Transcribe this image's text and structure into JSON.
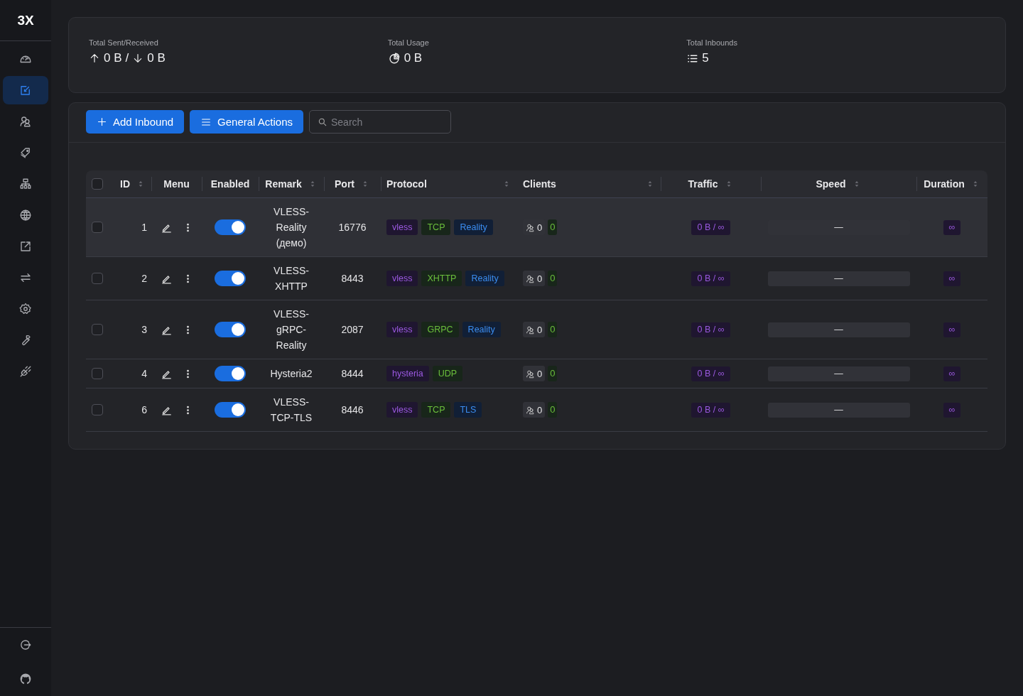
{
  "sidebar": {
    "logo": "3X",
    "items": [
      {
        "selected": false
      },
      {
        "selected": true
      },
      {
        "selected": false
      },
      {
        "selected": false
      },
      {
        "selected": false
      },
      {
        "selected": false
      },
      {
        "selected": false
      },
      {
        "selected": false
      },
      {
        "selected": false
      },
      {
        "selected": false
      },
      {
        "selected": false
      }
    ],
    "footer_items": [
      {
        "selected": false
      },
      {
        "selected": false
      }
    ]
  },
  "stats": [
    {
      "label": "Total Sent/Received",
      "sent": "0 B",
      "separator": "/",
      "received": "0 B"
    },
    {
      "label": "Total Usage",
      "value": "0 B"
    },
    {
      "label": "Total Inbounds",
      "value": "5"
    }
  ],
  "toolbar": {
    "buttons": [
      "Add Inbound",
      "General Actions"
    ],
    "search": {
      "placeholder": "Search"
    }
  },
  "table": {
    "select_all": {
      "checked": false
    },
    "columns": [
      {
        "label": "ID",
        "sortable": true
      },
      {
        "label": "Menu",
        "sortable": false
      },
      {
        "label": "Enabled",
        "sortable": false
      },
      {
        "label": "Remark",
        "sortable": true
      },
      {
        "label": "Port",
        "sortable": true
      },
      {
        "label": "Protocol",
        "sortable": true
      },
      {
        "label": "Clients",
        "sortable": true
      },
      {
        "label": "Traffic",
        "sortable": true
      },
      {
        "label": "Speed",
        "sortable": true
      },
      {
        "label": "Duration",
        "sortable": true
      }
    ],
    "rows": [
      {
        "checked": false,
        "highlighted": true,
        "id": "1",
        "enabled": true,
        "remark": "VLESS-Reality (демо)",
        "port": "16776",
        "tags": [
          {
            "text": "vless",
            "kind": "protocol"
          },
          {
            "text": "TCP",
            "kind": "network"
          },
          {
            "text": "Reality",
            "kind": "security"
          }
        ],
        "clients": "0",
        "online": "0",
        "traffic": "0 B / ∞",
        "speed": "—",
        "duration": "∞"
      },
      {
        "checked": false,
        "highlighted": false,
        "id": "2",
        "enabled": true,
        "remark": "VLESS-XHTTP",
        "port": "8443",
        "tags": [
          {
            "text": "vless",
            "kind": "protocol"
          },
          {
            "text": "XHTTP",
            "kind": "network"
          },
          {
            "text": "Reality",
            "kind": "security"
          }
        ],
        "clients": "0",
        "online": "0",
        "traffic": "0 B / ∞",
        "speed": "—",
        "duration": "∞"
      },
      {
        "checked": false,
        "highlighted": false,
        "id": "3",
        "enabled": true,
        "remark": "VLESS-gRPC-Reality",
        "port": "2087",
        "tags": [
          {
            "text": "vless",
            "kind": "protocol"
          },
          {
            "text": "GRPC",
            "kind": "network"
          },
          {
            "text": "Reality",
            "kind": "security"
          }
        ],
        "clients": "0",
        "online": "0",
        "traffic": "0 B / ∞",
        "speed": "—",
        "duration": "∞"
      },
      {
        "checked": false,
        "highlighted": false,
        "id": "4",
        "enabled": true,
        "remark": "Hysteria2",
        "port": "8444",
        "tags": [
          {
            "text": "hysteria",
            "kind": "protocol"
          },
          {
            "text": "UDP",
            "kind": "network"
          }
        ],
        "clients": "0",
        "online": "0",
        "traffic": "0 B / ∞",
        "speed": "—",
        "duration": "∞"
      },
      {
        "checked": false,
        "highlighted": false,
        "id": "6",
        "enabled": true,
        "remark": "VLESS-TCP-TLS",
        "port": "8446",
        "tags": [
          {
            "text": "vless",
            "kind": "protocol"
          },
          {
            "text": "TCP",
            "kind": "network"
          },
          {
            "text": "TLS",
            "kind": "security"
          }
        ],
        "clients": "0",
        "online": "0",
        "traffic": "0 B / ∞",
        "speed": "—",
        "duration": "∞"
      }
    ]
  }
}
